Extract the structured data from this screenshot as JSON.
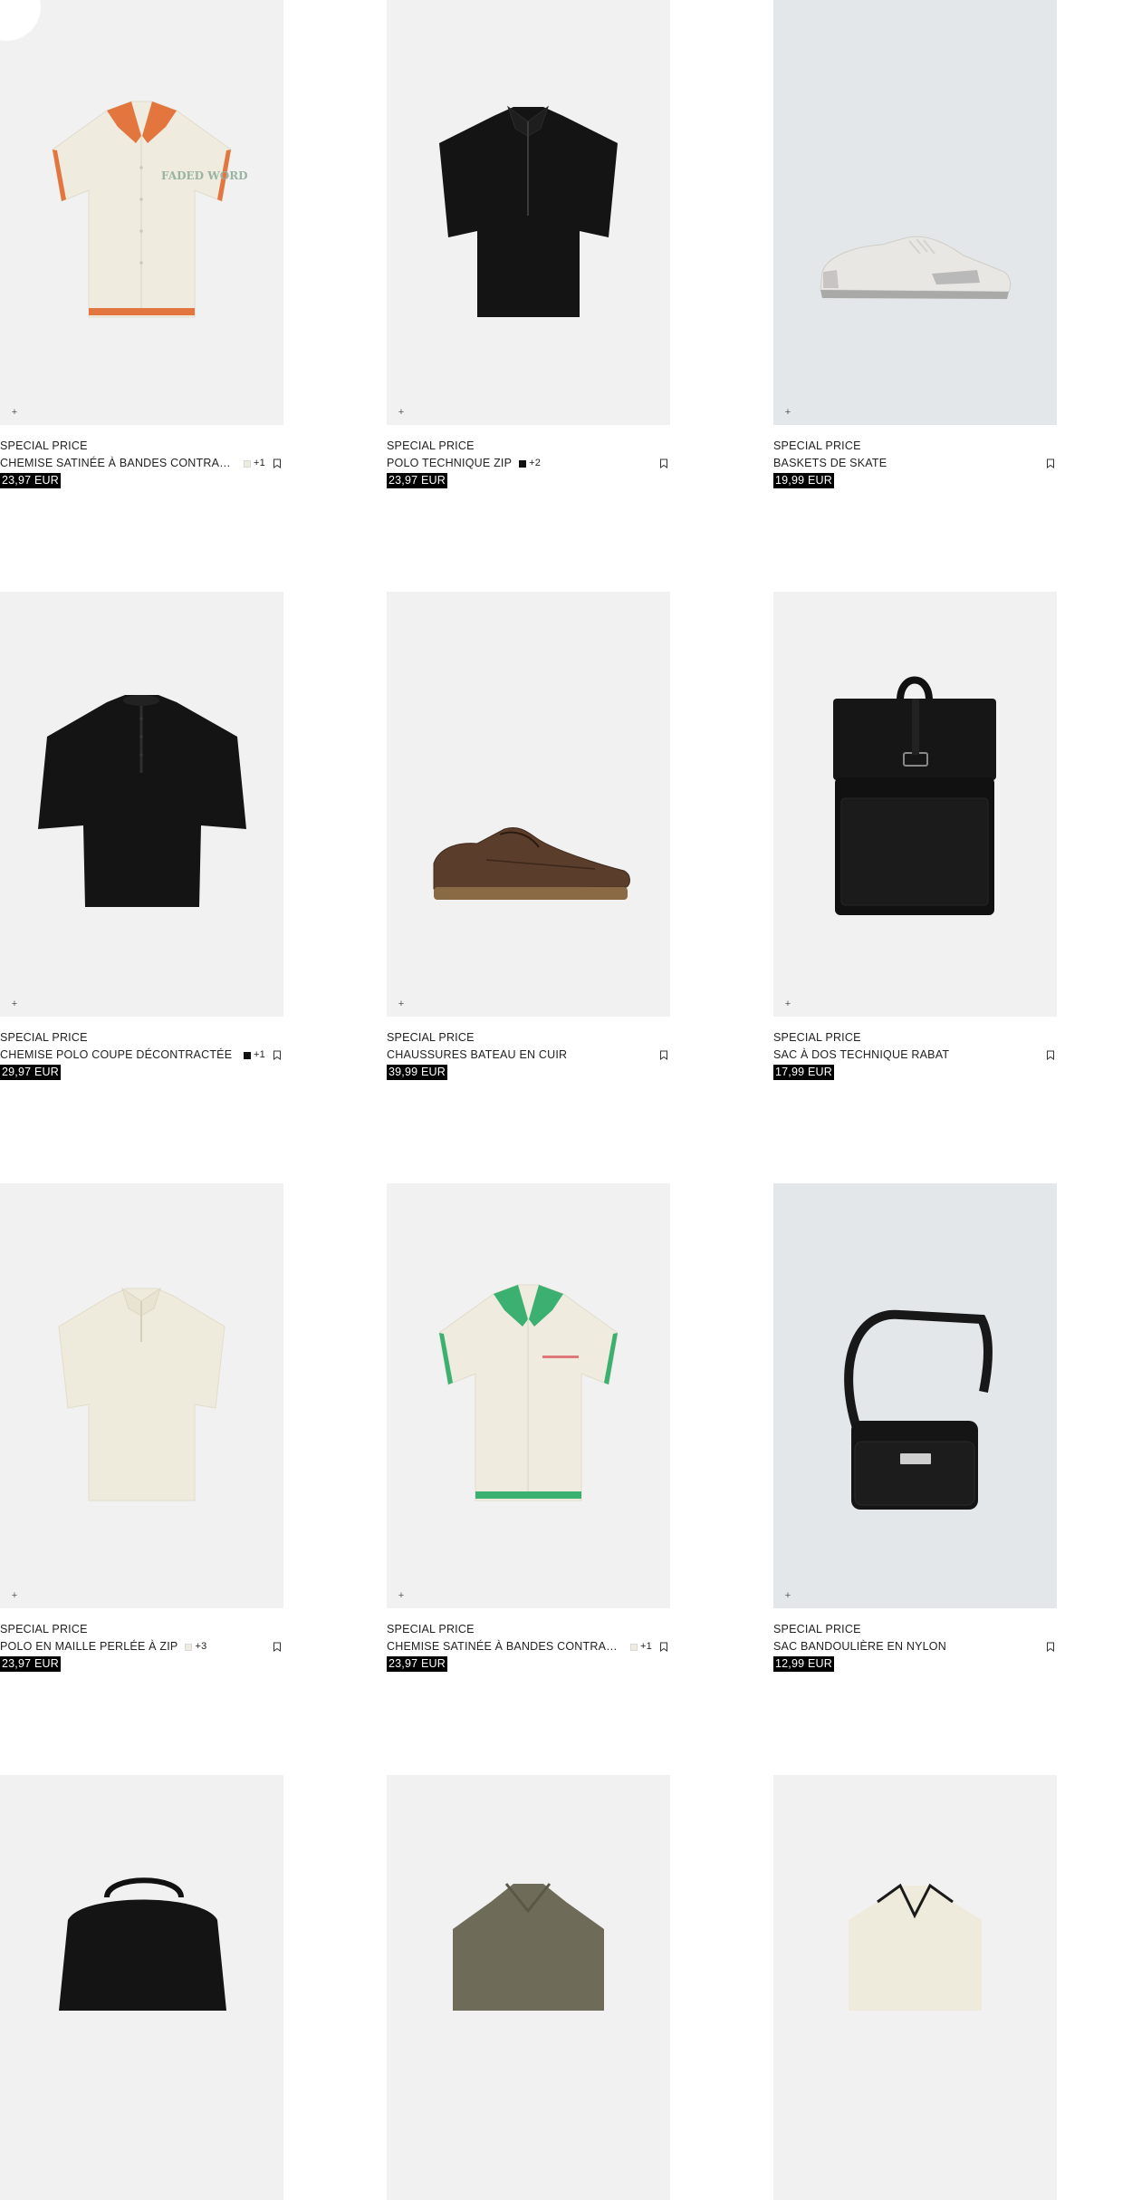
{
  "products": [
    {
      "tag": "SPECIAL PRICE",
      "name": "CHEMISE SATINÉE À BANDES CONTRASTÉES",
      "price": "23,97 EUR",
      "swatch_color": "#efecdf",
      "swatch_more": "+1",
      "image": "shirt-orange-trim"
    },
    {
      "tag": "SPECIAL PRICE",
      "name": "POLO TECHNIQUE ZIP",
      "price": "23,97 EUR",
      "swatch_color": "#111111",
      "swatch_more": "+2",
      "image": "polo-black-zip"
    },
    {
      "tag": "SPECIAL PRICE",
      "name": "BASKETS DE SKATE",
      "price": "19,99 EUR",
      "image": "sneaker-grey"
    },
    {
      "tag": "SPECIAL PRICE",
      "name": "CHEMISE POLO COUPE DÉCONTRACTÉE",
      "price": "29,97 EUR",
      "swatch_color": "#111111",
      "swatch_more": "+1",
      "image": "henley-black"
    },
    {
      "tag": "SPECIAL PRICE",
      "name": "CHAUSSURES BATEAU EN CUIR",
      "price": "39,99 EUR",
      "image": "boat-shoe-brown"
    },
    {
      "tag": "SPECIAL PRICE",
      "name": "SAC À DOS TECHNIQUE RABAT",
      "price": "17,99 EUR",
      "image": "backpack-black"
    },
    {
      "tag": "SPECIAL PRICE",
      "name": "POLO EN MAILLE PERLÉE À ZIP",
      "price": "23,97 EUR",
      "swatch_color": "#efecdf",
      "swatch_more": "+3",
      "image": "polo-cream-knit"
    },
    {
      "tag": "SPECIAL PRICE",
      "name": "CHEMISE SATINÉE À BANDES CONTRASTÉES",
      "price": "23,97 EUR",
      "swatch_color": "#efecdf",
      "swatch_more": "+1",
      "image": "shirt-green-trim"
    },
    {
      "tag": "SPECIAL PRICE",
      "name": "SAC BANDOULIÈRE EN NYLON",
      "price": "12,99 EUR",
      "image": "crossbody-black"
    },
    {
      "image": "bag-black-partial"
    },
    {
      "image": "shirt-olive-partial"
    },
    {
      "image": "shirt-cream-black-trim-partial"
    }
  ],
  "icons": {
    "quick_add": "+",
    "bookmark": "bookmark-icon"
  },
  "print_text": {
    "shirt_orange": "FADED WORD"
  }
}
